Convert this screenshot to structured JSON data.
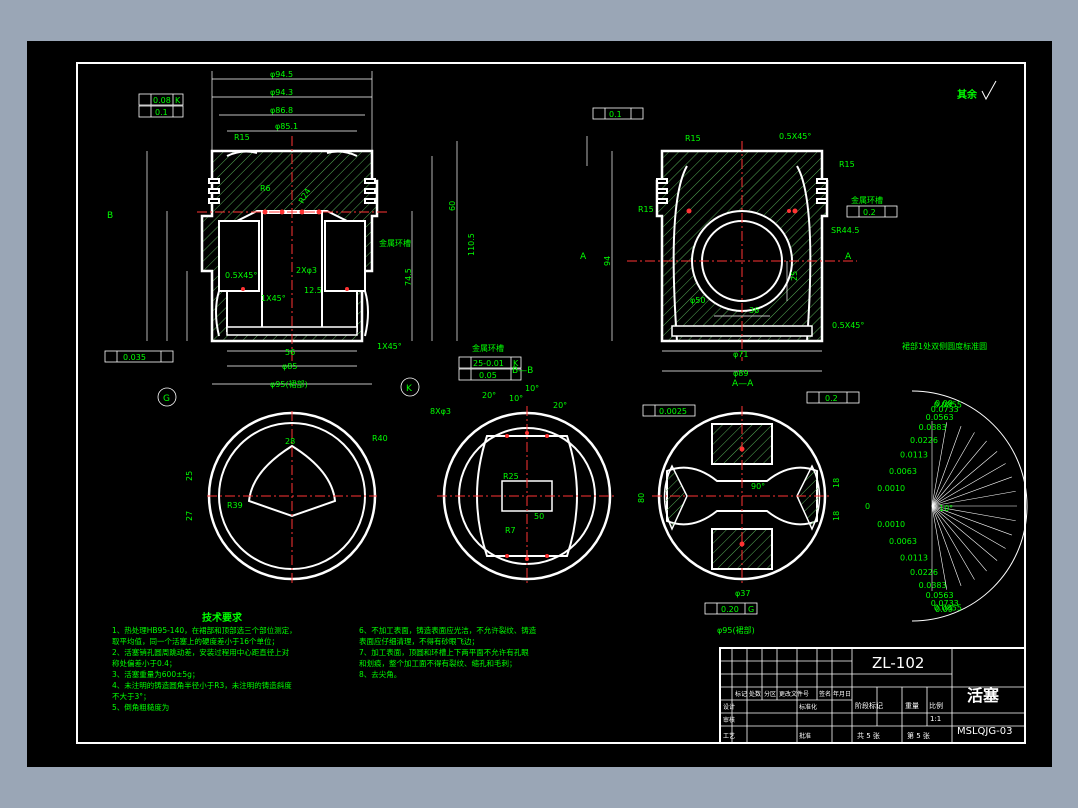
{
  "drawing": {
    "top_right_note": "其余",
    "title_block": {
      "drawing_number": "ZL-102",
      "part_name": "活塞",
      "code": "MSLQJG-03",
      "scale": "1:1",
      "sheet_total": "共 5 张",
      "sheet_index": "第 5 张",
      "material_col": "标记",
      "revisions_col": "处数",
      "zone_col": "分区",
      "doc_col": "更改文件号",
      "sign_col": "签名",
      "date_col": "年月日",
      "design": "设计",
      "standard": "标准化",
      "check": "审核",
      "process": "工艺",
      "approve": "批准",
      "stage": "阶段标记",
      "weight": "重量",
      "ratio": "比例"
    },
    "views": {
      "section_bb": "B—B",
      "section_aa": "A—A",
      "view_k": "K",
      "view_g": "G",
      "cut_a": "A",
      "cut_b": "B",
      "ring_chart_title": "裙部1处双侧圆度标准圆"
    },
    "dims_left": {
      "d1": "φ94.5",
      "d2": "φ94.3",
      "d3": "φ86.8",
      "d4": "φ85.1",
      "d_bottom": "φ95(裙部)",
      "d_85": "φ85",
      "r15": "R15",
      "r6": "R6",
      "r24": "R24",
      "chamfer1": "1X45°",
      "chamfer2": "0.5X45°",
      "chamfer3": "1X45°",
      "pin": "2Xφ3",
      "dim56": "56",
      "dim745": "74.5",
      "dim110": "110.5",
      "dim60": "60",
      "tol1": "0.08",
      "tol2": "0.1",
      "tol3": "0.035",
      "label_k": "K",
      "angle": "12.5",
      "gold_note": "金属环槽"
    },
    "dims_right": {
      "r15a": "R15",
      "r15b": "R15",
      "r15c": "R15",
      "ch": "0.5X45°",
      "sr": "SR44.5",
      "d94": "94",
      "d71": "φ71",
      "d89": "φ89",
      "d50": "φ50",
      "d36": "36",
      "d25": "25",
      "tol": "0.2",
      "tol_top": "0.1",
      "gold_note": "金属环槽",
      "ch2": "0.5X45°",
      "a_left": "A",
      "a_right": "A"
    },
    "gold_ring_box": {
      "note": "金属环槽",
      "v1": "25-0.01",
      "v2": "0.05",
      "ref": "K"
    },
    "bottom_views": {
      "v1_r40": "R40",
      "v1_r39": "R39",
      "v1_28": "28",
      "v1_25": "25",
      "v1_27": "27",
      "v2_r25": "R25",
      "v2_r7": "R7",
      "v2_50": "50",
      "v2_20a": "20°",
      "v2_10a": "10°",
      "v2_10b": "10°",
      "v2_20b": "20°",
      "v2_8x": "8Xφ3",
      "v3_tol": "0.0025",
      "v3_flat": "0.2",
      "v3_90": "90°",
      "v3_d37": "φ37",
      "v3_d95": "φ95(裙部)",
      "v3_020": "0.20",
      "v3_g": "G",
      "v3_80": "80",
      "v3_18a": "18",
      "v3_18b": "18"
    },
    "ring_values": [
      "0.09",
      "0.0855",
      "0.0733",
      "0.0563",
      "0.0383",
      "0.0226",
      "0.0113",
      "0.0063",
      "0.0010",
      "0",
      "0.0010",
      "0.0063",
      "0.0113",
      "0.0226",
      "0.0383",
      "0.0563",
      "0.0733",
      "0.0855",
      "0.09"
    ],
    "ring_angle": "10°",
    "tech_title": "技术要求",
    "tech_left": [
      "1、热处理HB95-140，在裙部和顶部选三个部位测定，",
      "   取平均值，同一个活塞上的硬度差小于16个单位；",
      "2、活塞销孔圆周跳动差，安装过程用中心距直径上对",
      "   称处偏差小于0.4；",
      "3、活塞重量为600±5g；",
      "4、未注明的铸造圆角半径小于R3，未注明的铸造斜度",
      "   不大于3°；",
      "5、倒角粗糙度为"
    ],
    "tech_right": [
      "6、不加工表面，铸造表面应光洁，不允许裂纹、铸造",
      "   表面应仔细清理，不得有砂眼飞边；",
      "7、加工表面，顶圆和环槽上下两平面不允许有孔眼",
      "   和划痕，整个加工面不得有裂纹、缩孔和毛刺；",
      "8、去尖角。"
    ]
  }
}
